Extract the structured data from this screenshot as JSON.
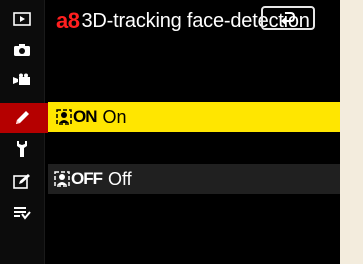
{
  "menu": {
    "code": "a8",
    "title": "3D-tracking face-detection"
  },
  "sidebar": {
    "items": [
      {
        "icon": "playback-icon"
      },
      {
        "icon": "camera-icon"
      },
      {
        "icon": "movie-icon"
      },
      {
        "icon": "pencil-icon",
        "active": true
      },
      {
        "icon": "wrench-icon"
      },
      {
        "icon": "retouch-icon"
      },
      {
        "icon": "my-menu-icon"
      }
    ]
  },
  "options": [
    {
      "symbol": "ON",
      "label": "On",
      "selected": true
    },
    {
      "symbol": "OFF",
      "label": "Off",
      "selected": false
    }
  ],
  "colors": {
    "accent": "#ff1f1f",
    "selected_bg": "#ffe600",
    "active_tab": "#b50000"
  }
}
